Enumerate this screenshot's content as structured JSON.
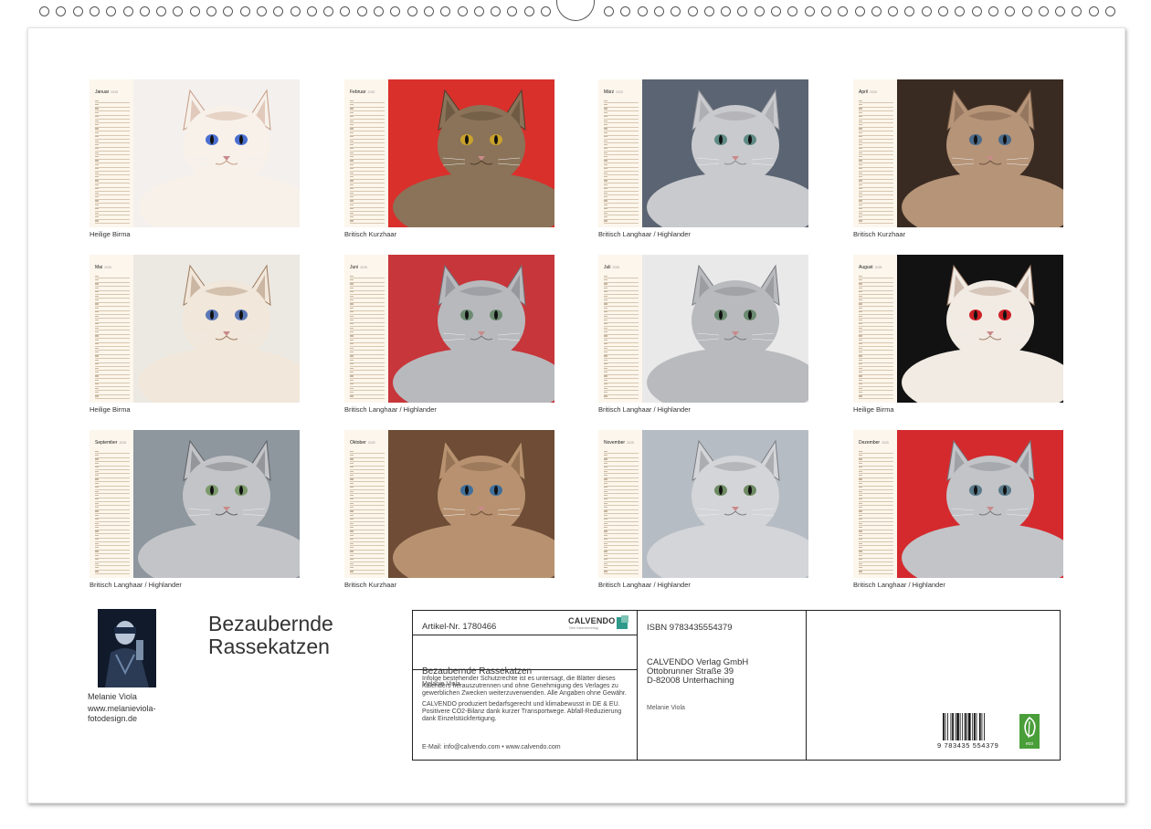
{
  "months": [
    {
      "name": "Januar",
      "year": "2025",
      "caption": "Heilige Birma",
      "colors": {
        "bg": "#f3f0ee",
        "fur": "#f7f1ea",
        "accent": "#c69a82",
        "eye": "#4a6fd1"
      }
    },
    {
      "name": "Februar",
      "year": "2025",
      "caption": "Britisch Kurzhaar",
      "colors": {
        "bg": "#d9302c",
        "fur": "#8a7358",
        "accent": "#4d3c2c",
        "eye": "#c9a22b"
      }
    },
    {
      "name": "März",
      "year": "2025",
      "caption": "Britisch Langhaar / Highlander",
      "colors": {
        "bg": "#5b6472",
        "fur": "#c9cace",
        "accent": "#8b8d93",
        "eye": "#5d8a84"
      }
    },
    {
      "name": "April",
      "year": "2025",
      "caption": "Britisch Kurzhaar",
      "colors": {
        "bg": "#3a2b22",
        "fur": "#b59478",
        "accent": "#6e5440",
        "eye": "#4a6a8a"
      }
    },
    {
      "name": "Mai",
      "year": "2025",
      "caption": "Heilige Birma",
      "colors": {
        "bg": "#ece8e2",
        "fur": "#f1e7da",
        "accent": "#9c7a5d",
        "eye": "#5a78b8"
      }
    },
    {
      "name": "Juni",
      "year": "2025",
      "caption": "Britisch Langhaar / Highlander",
      "colors": {
        "bg": "#c7363a",
        "fur": "#b8b9bd",
        "accent": "#6f7278",
        "eye": "#6c8c72"
      }
    },
    {
      "name": "Juli",
      "year": "2025",
      "caption": "Britisch Langhaar / Highlander",
      "colors": {
        "bg": "#e9e9ea",
        "fur": "#b9babd",
        "accent": "#77797d",
        "eye": "#6a8a70"
      }
    },
    {
      "name": "August",
      "year": "2025",
      "caption": "Heilige Birma",
      "colors": {
        "bg": "#121212",
        "fur": "#f1ebe4",
        "accent": "#a3806a",
        "eye": "#cf2026"
      }
    },
    {
      "name": "September",
      "year": "2025",
      "caption": "Britisch Langhaar / Highlander",
      "colors": {
        "bg": "#8e969e",
        "fur": "#c3c4c7",
        "accent": "#5d6065",
        "eye": "#7c9a6c"
      }
    },
    {
      "name": "Oktober",
      "year": "2025",
      "caption": "Britisch Kurzhaar",
      "colors": {
        "bg": "#6e4c36",
        "fur": "#b89270",
        "accent": "#6b4d33",
        "eye": "#3f6f9a"
      }
    },
    {
      "name": "November",
      "year": "2025",
      "caption": "Britisch Langhaar / Highlander",
      "colors": {
        "bg": "#b6bcc4",
        "fur": "#d4d5d8",
        "accent": "#7a7d83",
        "eye": "#6d8a62"
      }
    },
    {
      "name": "Dezember",
      "year": "2025",
      "caption": "Britisch Langhaar / Highlander",
      "colors": {
        "bg": "#d42a2d",
        "fur": "#c2c4c8",
        "accent": "#74777d",
        "eye": "#5a7a8a"
      }
    }
  ],
  "author": {
    "name": "Melanie Viola",
    "website": "www.melanieviola-fotodesign.de"
  },
  "title_line1": "Bezaubernde",
  "title_line2": "Rassekatzen",
  "info": {
    "artikel": "Artikel-Nr. 1780466",
    "logo_word": "CALVENDO",
    "logo_tag": "Dein Kalenderverlag",
    "book_title": "Bezaubernde Rassekatzen",
    "book_author": "Melanie Viola",
    "legal_1": "Infolge bestehender Schutzrechte ist es untersagt, die Blätter dieses Kalenders herauszutrennen und ohne Genehmigung des Verlages zu gewerblichen Zwecken weiterzuverwenden. Alle Angaben ohne Gewähr.",
    "legal_2": "CALVENDO produziert bedarfsgerecht und klimabewusst in DE & EU. Positivere CO2-Bilanz dank kurzer Transportwege. Abfall-Reduzierung dank Einzelstückfertigung.",
    "email": "E-Mail: info@calvendo.com • www.calvendo.com",
    "isbn": "ISBN 9783435554379",
    "publisher_1": "CALVENDO Verlag GmbH",
    "publisher_2": "Ottobrunner Straße 39",
    "publisher_3": "D-82008 Unterhaching",
    "publisher_author": "Melanie Viola",
    "barcode_number": "9 783435 554379",
    "eco_label": "eco"
  },
  "colors": {
    "brand": "#2e9a8c",
    "eco": "#4a9e3a",
    "calendar_bg": "#fcf6ec"
  }
}
